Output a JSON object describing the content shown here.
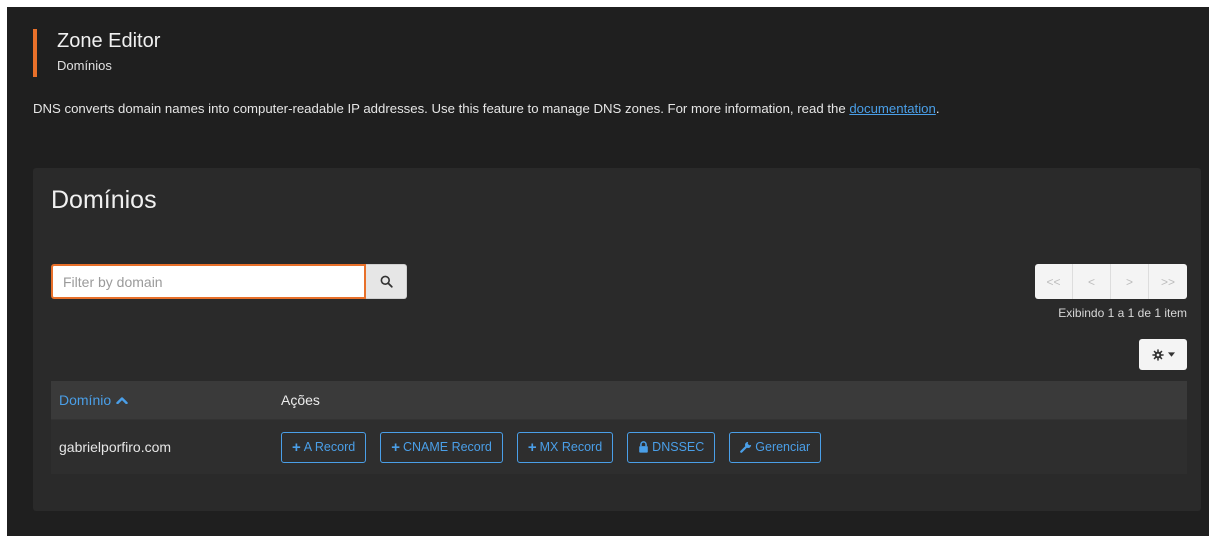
{
  "header": {
    "title": "Zone Editor",
    "subtitle": "Domínios"
  },
  "description": {
    "text": "DNS converts domain names into computer-readable IP addresses. Use this feature to manage DNS zones. For more information, read the ",
    "link": "documentation",
    "end": "."
  },
  "panel": {
    "title": "Domínios"
  },
  "search": {
    "placeholder": "Filter by domain",
    "value": ""
  },
  "pagination": {
    "first": "<<",
    "prev": "<",
    "next": ">",
    "last": ">>",
    "showing": "Exibindo 1 a 1 de 1 item"
  },
  "table": {
    "columns": [
      "Domínio",
      "Ações"
    ],
    "rows": [
      {
        "domain": "gabrielporfiro.com"
      }
    ],
    "actions": [
      "A Record",
      "CNAME Record",
      "MX Record",
      "DNSSEC",
      "Gerenciar"
    ]
  },
  "colors": {
    "accent": "#e8702a",
    "link": "#4a9fe8",
    "background": "#1f1f1f",
    "panel": "#2a2a2a"
  }
}
